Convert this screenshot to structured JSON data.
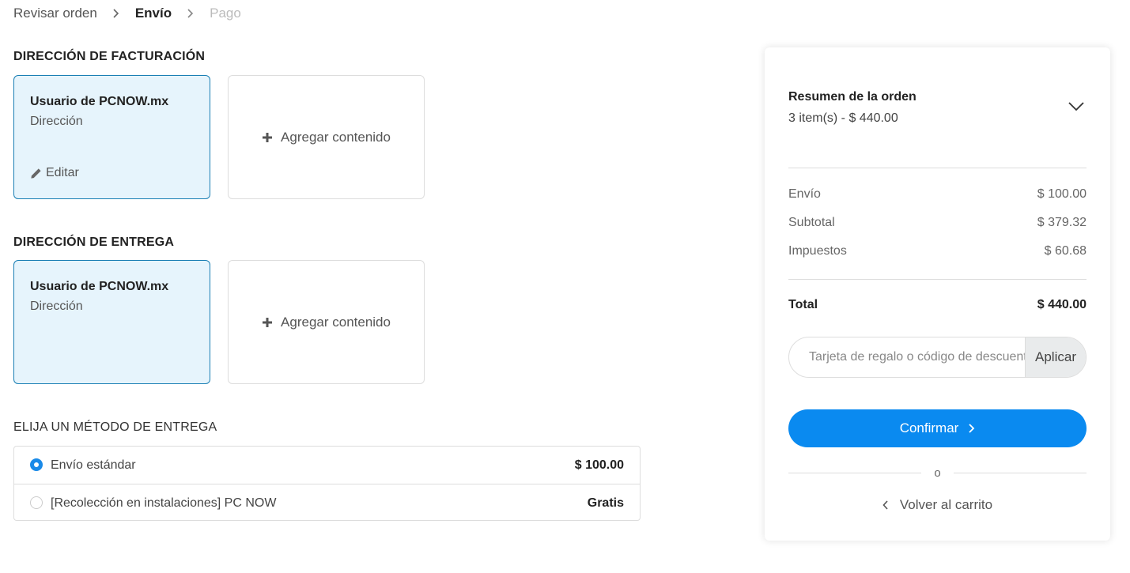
{
  "breadcrumb": {
    "step1": "Revisar orden",
    "step2": "Envío",
    "step3": "Pago"
  },
  "billing": {
    "title": "DIRECCIÓN DE FACTURACIÓN",
    "card_name": "Usuario de PCNOW.mx",
    "card_address": "Dirección",
    "edit_label": "Editar",
    "add_label": "Agregar contenido"
  },
  "delivery": {
    "title": "DIRECCIÓN DE ENTREGA",
    "card_name": "Usuario de PCNOW.mx",
    "card_address": "Dirección",
    "add_label": "Agregar contenido"
  },
  "shipping_method": {
    "title": "ELIJA UN MÉTODO DE ENTREGA",
    "options": [
      {
        "label": "Envío estándar",
        "price": "$ 100.00",
        "selected": true
      },
      {
        "label": "[Recolección en instalaciones] PC NOW",
        "price": "Gratis",
        "selected": false
      }
    ]
  },
  "summary": {
    "title": "Resumen de la orden",
    "subtitle": "3 item(s) -  $ 440.00",
    "rows": [
      {
        "label": "Envío",
        "value": "$ 100.00"
      },
      {
        "label": "Subtotal",
        "value": "$ 379.32"
      },
      {
        "label": "Impuestos",
        "value": "$ 60.68"
      }
    ],
    "total_label": "Total",
    "total_value": "$ 440.00",
    "coupon_placeholder": "Tarjeta de regalo o código de descuento",
    "apply_label": "Aplicar",
    "confirm_label": "Confirmar",
    "or_label": "o",
    "back_label": "Volver al carrito"
  },
  "colors": {
    "accent": "#0a8af0",
    "selected_card_bg": "#e6f4fc",
    "selected_card_border": "#1a7fb4"
  }
}
